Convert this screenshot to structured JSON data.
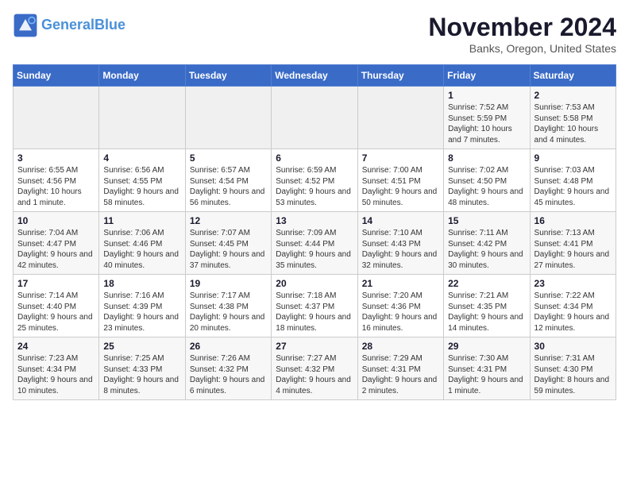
{
  "logo": {
    "line1": "General",
    "line2": "Blue"
  },
  "title": "November 2024",
  "subtitle": "Banks, Oregon, United States",
  "days_of_week": [
    "Sunday",
    "Monday",
    "Tuesday",
    "Wednesday",
    "Thursday",
    "Friday",
    "Saturday"
  ],
  "weeks": [
    [
      {
        "day": "",
        "info": ""
      },
      {
        "day": "",
        "info": ""
      },
      {
        "day": "",
        "info": ""
      },
      {
        "day": "",
        "info": ""
      },
      {
        "day": "",
        "info": ""
      },
      {
        "day": "1",
        "info": "Sunrise: 7:52 AM\nSunset: 5:59 PM\nDaylight: 10 hours\nand 7 minutes."
      },
      {
        "day": "2",
        "info": "Sunrise: 7:53 AM\nSunset: 5:58 PM\nDaylight: 10 hours\nand 4 minutes."
      }
    ],
    [
      {
        "day": "3",
        "info": "Sunrise: 6:55 AM\nSunset: 4:56 PM\nDaylight: 10 hours\nand 1 minute."
      },
      {
        "day": "4",
        "info": "Sunrise: 6:56 AM\nSunset: 4:55 PM\nDaylight: 9 hours\nand 58 minutes."
      },
      {
        "day": "5",
        "info": "Sunrise: 6:57 AM\nSunset: 4:54 PM\nDaylight: 9 hours\nand 56 minutes."
      },
      {
        "day": "6",
        "info": "Sunrise: 6:59 AM\nSunset: 4:52 PM\nDaylight: 9 hours\nand 53 minutes."
      },
      {
        "day": "7",
        "info": "Sunrise: 7:00 AM\nSunset: 4:51 PM\nDaylight: 9 hours\nand 50 minutes."
      },
      {
        "day": "8",
        "info": "Sunrise: 7:02 AM\nSunset: 4:50 PM\nDaylight: 9 hours\nand 48 minutes."
      },
      {
        "day": "9",
        "info": "Sunrise: 7:03 AM\nSunset: 4:48 PM\nDaylight: 9 hours\nand 45 minutes."
      }
    ],
    [
      {
        "day": "10",
        "info": "Sunrise: 7:04 AM\nSunset: 4:47 PM\nDaylight: 9 hours\nand 42 minutes."
      },
      {
        "day": "11",
        "info": "Sunrise: 7:06 AM\nSunset: 4:46 PM\nDaylight: 9 hours\nand 40 minutes."
      },
      {
        "day": "12",
        "info": "Sunrise: 7:07 AM\nSunset: 4:45 PM\nDaylight: 9 hours\nand 37 minutes."
      },
      {
        "day": "13",
        "info": "Sunrise: 7:09 AM\nSunset: 4:44 PM\nDaylight: 9 hours\nand 35 minutes."
      },
      {
        "day": "14",
        "info": "Sunrise: 7:10 AM\nSunset: 4:43 PM\nDaylight: 9 hours\nand 32 minutes."
      },
      {
        "day": "15",
        "info": "Sunrise: 7:11 AM\nSunset: 4:42 PM\nDaylight: 9 hours\nand 30 minutes."
      },
      {
        "day": "16",
        "info": "Sunrise: 7:13 AM\nSunset: 4:41 PM\nDaylight: 9 hours\nand 27 minutes."
      }
    ],
    [
      {
        "day": "17",
        "info": "Sunrise: 7:14 AM\nSunset: 4:40 PM\nDaylight: 9 hours\nand 25 minutes."
      },
      {
        "day": "18",
        "info": "Sunrise: 7:16 AM\nSunset: 4:39 PM\nDaylight: 9 hours\nand 23 minutes."
      },
      {
        "day": "19",
        "info": "Sunrise: 7:17 AM\nSunset: 4:38 PM\nDaylight: 9 hours\nand 20 minutes."
      },
      {
        "day": "20",
        "info": "Sunrise: 7:18 AM\nSunset: 4:37 PM\nDaylight: 9 hours\nand 18 minutes."
      },
      {
        "day": "21",
        "info": "Sunrise: 7:20 AM\nSunset: 4:36 PM\nDaylight: 9 hours\nand 16 minutes."
      },
      {
        "day": "22",
        "info": "Sunrise: 7:21 AM\nSunset: 4:35 PM\nDaylight: 9 hours\nand 14 minutes."
      },
      {
        "day": "23",
        "info": "Sunrise: 7:22 AM\nSunset: 4:34 PM\nDaylight: 9 hours\nand 12 minutes."
      }
    ],
    [
      {
        "day": "24",
        "info": "Sunrise: 7:23 AM\nSunset: 4:34 PM\nDaylight: 9 hours\nand 10 minutes."
      },
      {
        "day": "25",
        "info": "Sunrise: 7:25 AM\nSunset: 4:33 PM\nDaylight: 9 hours\nand 8 minutes."
      },
      {
        "day": "26",
        "info": "Sunrise: 7:26 AM\nSunset: 4:32 PM\nDaylight: 9 hours\nand 6 minutes."
      },
      {
        "day": "27",
        "info": "Sunrise: 7:27 AM\nSunset: 4:32 PM\nDaylight: 9 hours\nand 4 minutes."
      },
      {
        "day": "28",
        "info": "Sunrise: 7:29 AM\nSunset: 4:31 PM\nDaylight: 9 hours\nand 2 minutes."
      },
      {
        "day": "29",
        "info": "Sunrise: 7:30 AM\nSunset: 4:31 PM\nDaylight: 9 hours\nand 1 minute."
      },
      {
        "day": "30",
        "info": "Sunrise: 7:31 AM\nSunset: 4:30 PM\nDaylight: 8 hours\nand 59 minutes."
      }
    ]
  ]
}
